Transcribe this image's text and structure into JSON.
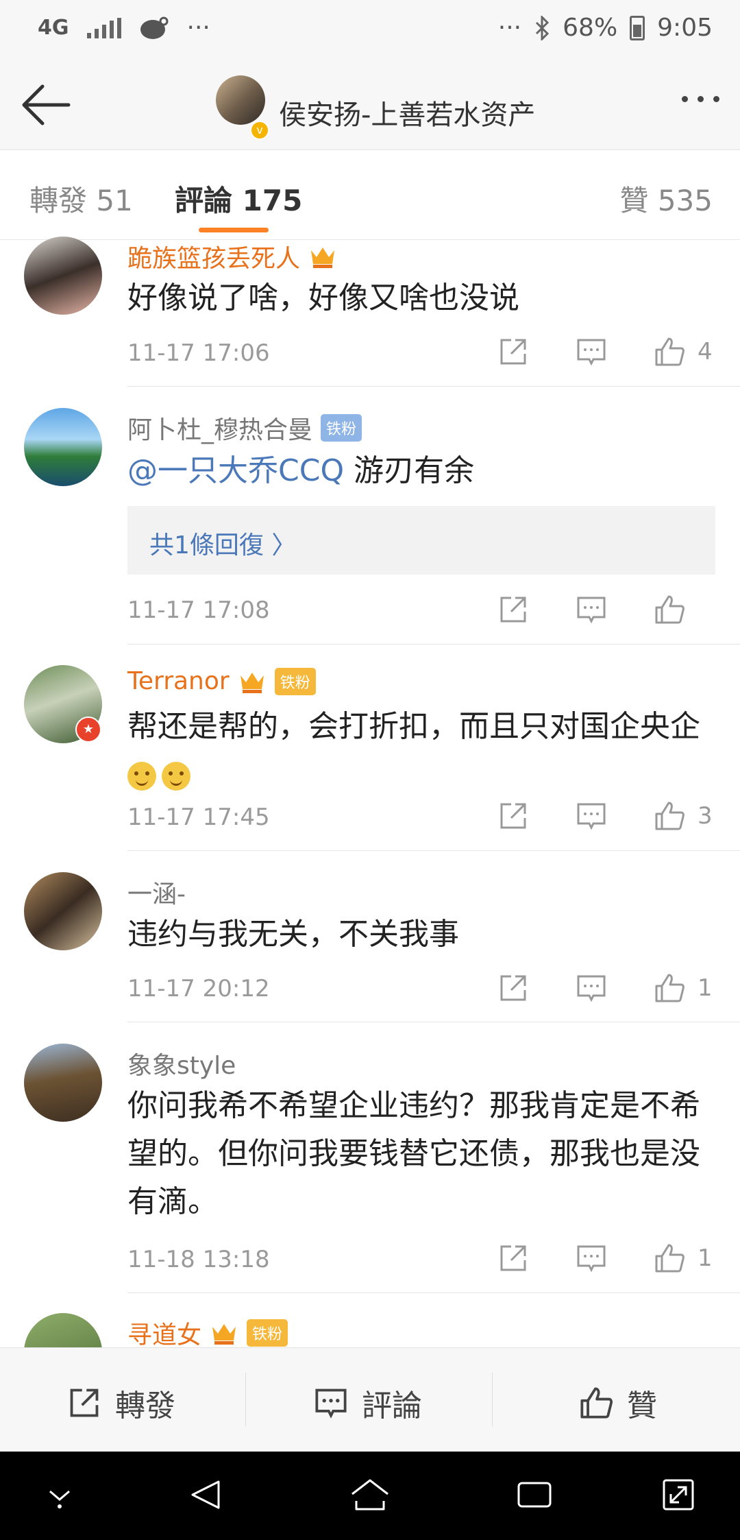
{
  "status_bar": {
    "network": "4G",
    "left_more": "···",
    "right_more": "···",
    "battery": "68%",
    "time": "9:05"
  },
  "header": {
    "title": "侯安扬-上善若水资产"
  },
  "tabs": [
    {
      "label": "轉發 51"
    },
    {
      "label": "評論 175"
    },
    {
      "label": "贊 535"
    }
  ],
  "comments": [
    {
      "name": "跪族篮孩丢死人",
      "text": "好像说了啥，好像又啥也没说",
      "time": "11-17 17:06",
      "likes": "4"
    },
    {
      "name": "阿卜杜_穆热合曼",
      "badge": "铁粉",
      "mention": "@一只大乔CCQ",
      "text": " 游刃有余",
      "reply": "共1條回復 〉",
      "time": "11-17 17:08",
      "likes": ""
    },
    {
      "name": "Terranor",
      "badge": "铁粉",
      "text": "帮还是帮的，会打折扣，而且只对国企央企",
      "time": "11-17 17:45",
      "likes": "3"
    },
    {
      "name": "一涵-",
      "text": "违约与我无关，不关我事",
      "time": "11-17 20:12",
      "likes": "1"
    },
    {
      "name": "象象style",
      "text": "你问我希不希望企业违约？那我肯定是不希望的。但你问我要钱替它还债，那我也是没有滴。",
      "time": "11-18 13:18",
      "likes": "1"
    },
    {
      "name": "寻道女",
      "badge": "铁粉"
    }
  ],
  "bottom_bar": {
    "forward": "轉發",
    "comment": "評論",
    "like": "贊"
  },
  "colors": {
    "accent": "#fd8225",
    "name_orange": "#e8711c",
    "link_blue": "#4a78b8"
  }
}
